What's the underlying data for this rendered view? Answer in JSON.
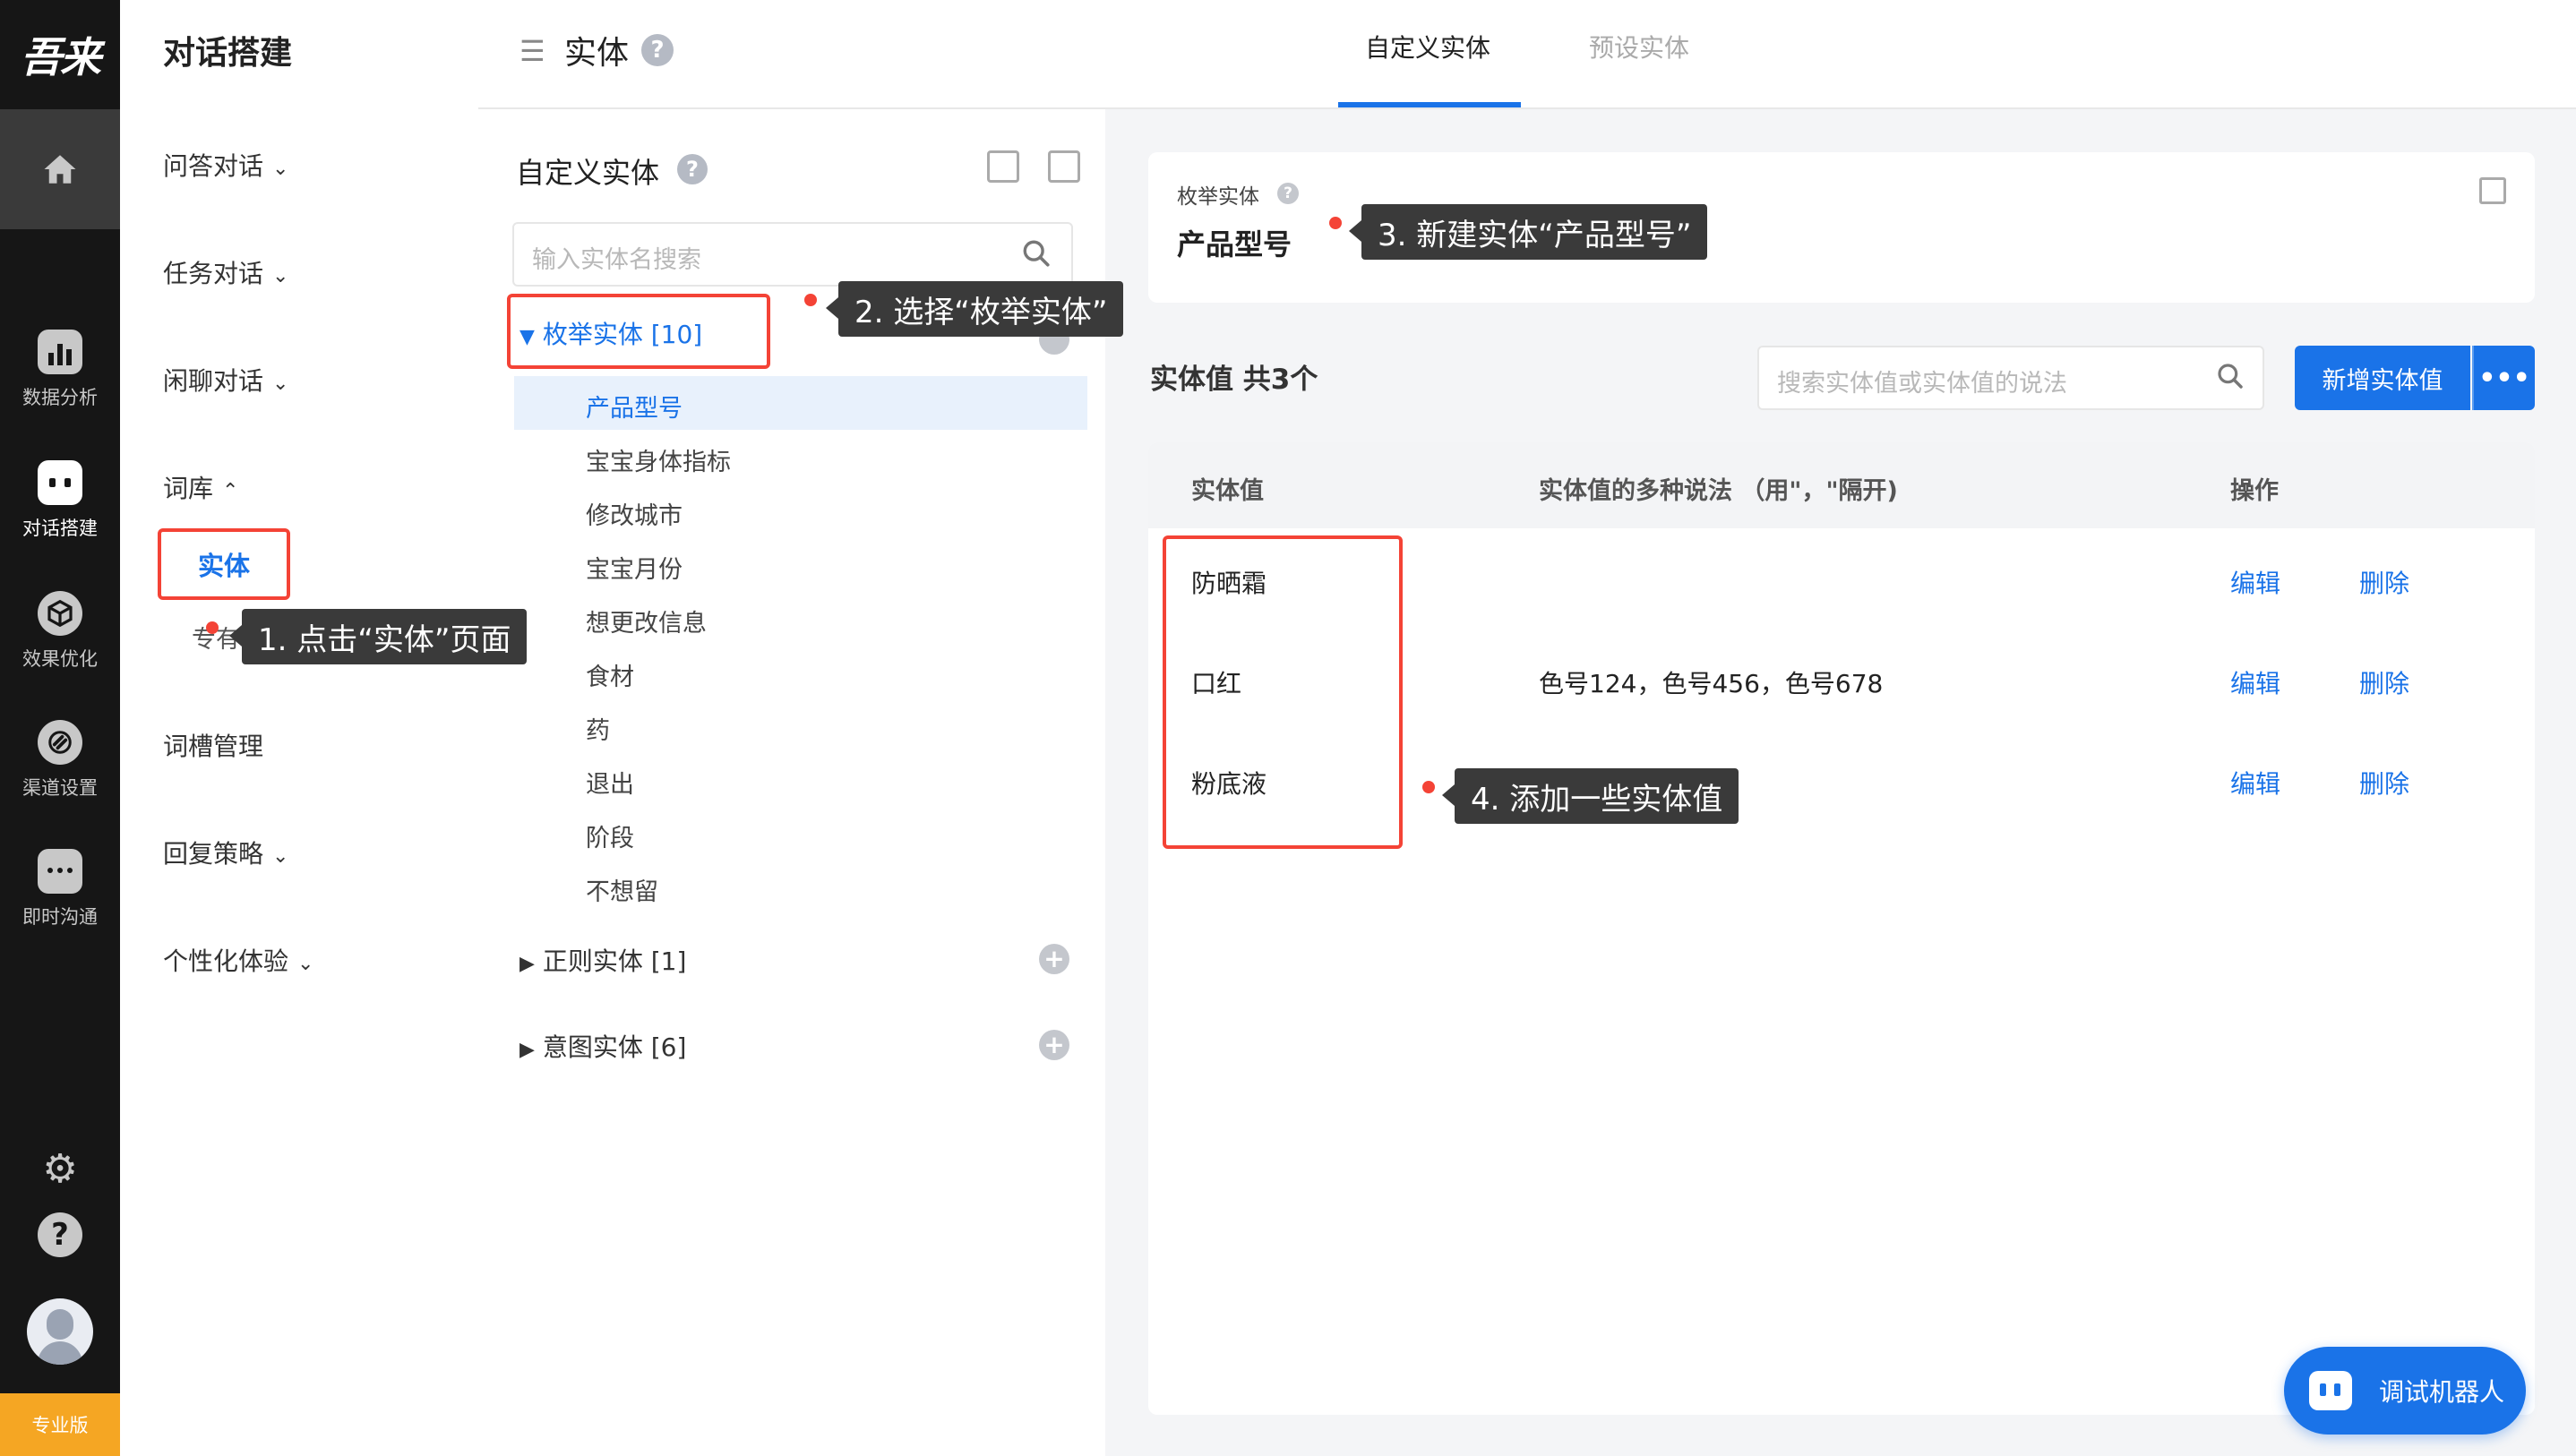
{
  "app": {
    "logo": "吾来",
    "pro_badge": "专业版"
  },
  "rail": {
    "items": [
      {
        "label": "数据分析",
        "icon": "bar-chart-icon"
      },
      {
        "label": "对话搭建",
        "icon": "robot-icon"
      },
      {
        "label": "效果优化",
        "icon": "cube-icon"
      },
      {
        "label": "渠道设置",
        "icon": "channel-icon"
      },
      {
        "label": "即时沟通",
        "icon": "chat-bubble-icon"
      }
    ]
  },
  "nav": {
    "title": "对话搭建",
    "items": [
      "问答对话",
      "任务对话",
      "闲聊对话",
      "词库",
      "词槽管理",
      "回复策略",
      "个性化体验"
    ],
    "entity": "实体",
    "special": "专有词汇"
  },
  "header": {
    "title": "实体",
    "tabs": [
      "自定义实体",
      "预设实体"
    ]
  },
  "entity_panel": {
    "title": "自定义实体",
    "search_placeholder": "输入实体名搜索",
    "enum_group": "枚举实体 [10]",
    "enum_items": [
      "产品型号",
      "宝宝身体指标",
      "修改城市",
      "宝宝月份",
      "想更改信息",
      "食材",
      "药",
      "退出",
      "阶段",
      "不想留"
    ],
    "regex_group": "正则实体 [1]",
    "intent_group": "意图实体 [6]"
  },
  "entity_card": {
    "type": "枚举实体",
    "name": "产品型号"
  },
  "values": {
    "title": "实体值  共3个",
    "search_placeholder": "搜索实体值或实体值的说法",
    "add_button": "新增实体值",
    "more": "•••",
    "columns": [
      "实体值",
      "实体值的多种说法 （用\"，\"隔开)",
      "操作"
    ],
    "rows": [
      {
        "value": "防晒霜",
        "synonyms": "",
        "edit": "编辑",
        "delete": "删除"
      },
      {
        "value": "口红",
        "synonyms": "色号124，色号456，色号678",
        "edit": "编辑",
        "delete": "删除"
      },
      {
        "value": "粉底液",
        "synonyms": "",
        "edit": "编辑",
        "delete": "删除"
      }
    ]
  },
  "annotations": {
    "step1": "1. 点击“实体”页面",
    "step2": "2. 选择“枚举实体”",
    "step3": "3. 新建实体“产品型号”",
    "step4": "4. 添加一些实体值"
  },
  "robot_button": "调试机器人",
  "colors": {
    "accent": "#1a73e8",
    "highlight": "#f44336",
    "rail": "#161616",
    "pro": "#f5a623"
  }
}
